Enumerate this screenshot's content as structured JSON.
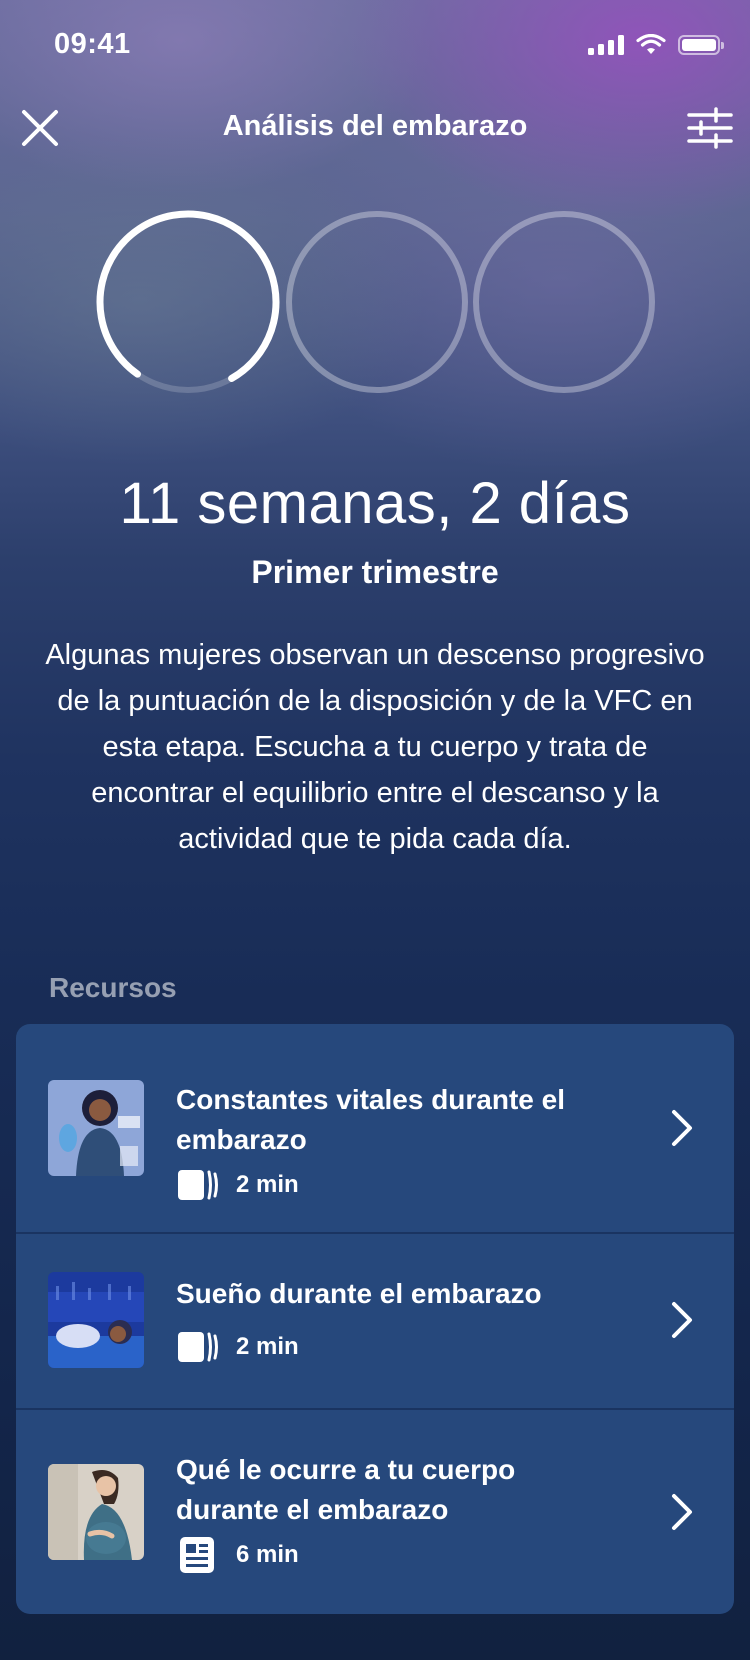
{
  "status_bar": {
    "time": "09:41"
  },
  "header": {
    "title": "Análisis del embarazo"
  },
  "progress": {
    "current_ring_fraction": 0.82,
    "rings_total": 3,
    "active_ring_index": 0
  },
  "headline": "11 semanas, 2 días",
  "subtitle": "Primer trimestre",
  "description": "Algunas mujeres observan un descenso progresivo de la puntuación de la disposición y de la VFC en esta etapa. Escucha a tu cuerpo y trata de encontrar el equilibrio entre el descanso y la actividad que te pida cada día.",
  "resources": {
    "label": "Recursos",
    "items": [
      {
        "title": "Constantes vitales durante el embarazo",
        "duration": "2 min",
        "type_icon": "story-cards-icon",
        "thumb_colors": [
          "#9bb2dc",
          "#7b8fc8"
        ]
      },
      {
        "title": "Sueño durante el embarazo",
        "duration": "2 min",
        "type_icon": "story-cards-icon",
        "thumb_colors": [
          "#1f3fa8",
          "#2e56c8"
        ]
      },
      {
        "title": "Qué le ocurre a tu cuerpo durante el embarazo",
        "duration": "6 min",
        "type_icon": "article-icon",
        "thumb_colors": [
          "#d9d2c8",
          "#4a6f88"
        ]
      }
    ]
  },
  "colors": {
    "card_bg": "#26487c",
    "divider": "#1a3461",
    "ring_inactive": "rgba(255,255,255,0.35)",
    "ring_active": "#ffffff"
  }
}
